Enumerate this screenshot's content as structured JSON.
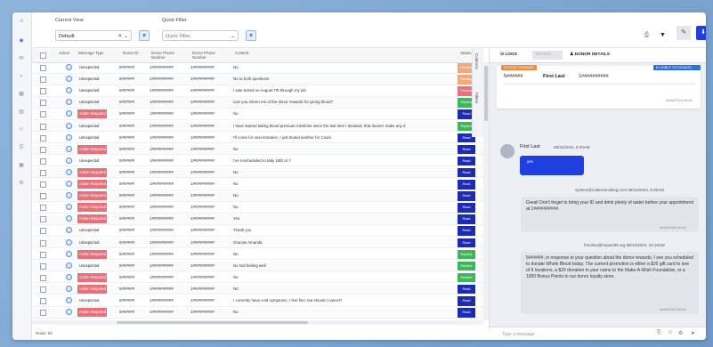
{
  "filters": {
    "current_view_label": "Current View",
    "current_view_value": "Default",
    "quick_filter_label": "Quick Filter",
    "quick_filter_value": "Quick Filter"
  },
  "grid": {
    "headers": [
      "Action",
      "Message Type",
      "Donor ID",
      "Donor Phone Number",
      "Donor Phone Number",
      "Content",
      "Status"
    ],
    "rows": [
      {
        "type": "Unexpected",
        "req": false,
        "d1": "5######",
        "d2": "1##########",
        "d3": "1##########",
        "content": "No",
        "status": "Pending",
        "color": "#f0a97a"
      },
      {
        "type": "Unexpected",
        "req": false,
        "d1": "5######",
        "d2": "1##########",
        "d3": "1##########",
        "content": "No to both questions",
        "status": "Pending",
        "color": "#f0a97a"
      },
      {
        "type": "Unexpected",
        "req": false,
        "d1": "5######",
        "d2": "1##########",
        "d3": "1##########",
        "content": "I was tested on August 7th through my job.",
        "status": "Pending",
        "color": "#e8707a"
      },
      {
        "type": "Unexpected",
        "req": false,
        "d1": "5######",
        "d2": "1##########",
        "d3": "1##########",
        "content": "Can you inform me of the donor rewards for giving blood?",
        "status": "Replied",
        "color": "#3fb55b"
      },
      {
        "type": "Action Required",
        "req": true,
        "d1": "5######",
        "d2": "1##########",
        "d3": "1##########",
        "content": "No",
        "status": "Read",
        "color": "#1d2bb0"
      },
      {
        "type": "Unexpected",
        "req": false,
        "d1": "5######",
        "d2": "1##########",
        "d3": "1##########",
        "content": "I have started taking blood pressure medicine since the last time I donated, that doesn't make any d",
        "status": "Replied",
        "color": "#3fb55b"
      },
      {
        "type": "Unexpected",
        "req": false,
        "d1": "5######",
        "d2": "1##########",
        "d3": "1##########",
        "content": "I'll come for next donation, I just texted another for Covid",
        "status": "Read",
        "color": "#1d2bb0"
      },
      {
        "type": "Action Required",
        "req": true,
        "d1": "5######",
        "d2": "1##########",
        "d3": "1##########",
        "content": "No",
        "status": "Read",
        "color": "#1d2bb0"
      },
      {
        "type": "Unexpected",
        "req": false,
        "d1": "5######",
        "d2": "1##########",
        "d3": "1##########",
        "content": "I've rescheduled to May 18th at 7",
        "status": "Read",
        "color": "#1d2bb0"
      },
      {
        "type": "Action Required",
        "req": true,
        "d1": "5######",
        "d2": "1##########",
        "d3": "1##########",
        "content": "No",
        "status": "Read",
        "color": "#1d2bb0"
      },
      {
        "type": "Action Required",
        "req": true,
        "d1": "5######",
        "d2": "1##########",
        "d3": "1##########",
        "content": "No",
        "status": "Read",
        "color": "#1d2bb0"
      },
      {
        "type": "Action Required",
        "req": true,
        "d1": "5######",
        "d2": "1##########",
        "d3": "1##########",
        "content": "No",
        "status": "Read",
        "color": "#1d2bb0"
      },
      {
        "type": "Action Required",
        "req": true,
        "d1": "5######",
        "d2": "1##########",
        "d3": "1##########",
        "content": "No",
        "status": "Read",
        "color": "#1d2bb0"
      },
      {
        "type": "Action Required",
        "req": true,
        "d1": "5######",
        "d2": "1##########",
        "d3": "1##########",
        "content": "Yes",
        "status": "Read",
        "color": "#1d2bb0"
      },
      {
        "type": "Unexpected",
        "req": false,
        "d1": "5######",
        "d2": "1##########",
        "d3": "1##########",
        "content": "Thank you",
        "status": "Read",
        "color": "#1d2bb0"
      },
      {
        "type": "Unexpected",
        "req": false,
        "d1": "5######",
        "d2": "1##########",
        "d3": "1##########",
        "content": "Gracias Amanda",
        "status": "Read",
        "color": "#1d2bb0"
      },
      {
        "type": "Action Required",
        "req": true,
        "d1": "5######",
        "d2": "1##########",
        "d3": "1##########",
        "content": "No",
        "status": "Replied",
        "color": "#3fb55b"
      },
      {
        "type": "Unexpected",
        "req": false,
        "d1": "5######",
        "d2": "1##########",
        "d3": "1##########",
        "content": "No Not feeling well",
        "status": "Replied",
        "color": "#3fb55b"
      },
      {
        "type": "Action Required",
        "req": true,
        "d1": "5######",
        "d2": "1##########",
        "d3": "1##########",
        "content": "No",
        "status": "Replied",
        "color": "#3fb55b"
      },
      {
        "type": "Action Required",
        "req": true,
        "d1": "5######",
        "d2": "1##########",
        "d3": "1##########",
        "content": "No",
        "status": "Read",
        "color": "#1d2bb0"
      },
      {
        "type": "Unexpected",
        "req": false,
        "d1": "5######",
        "d2": "1##########",
        "d3": "1##########",
        "content": "I currently have cold symptoms. I feel fine, but should I cancel?",
        "status": "Read",
        "color": "#1d2bb0"
      },
      {
        "type": "Action Required",
        "req": true,
        "d1": "5######",
        "d2": "1##########",
        "d3": "1##########",
        "content": "No",
        "status": "Read",
        "color": "#1d2bb0"
      }
    ],
    "rows_label": "Rows: 50",
    "side_tabs": [
      "Columns",
      "Filters"
    ]
  },
  "panel": {
    "tabs": [
      "LOGS",
      "NOTES",
      "DONOR DETAILS"
    ],
    "donor_chip_left": "STATUS: PENDING",
    "donor_chip_right": "ELIGIBLE TO DONATE: YES",
    "donor_id": "5######",
    "donor_name": "First Last",
    "donor_phone": "1##########",
    "card_ts": "##/##/2024 ##:##",
    "incoming_name": "First Last",
    "incoming_meta": "08/15/2024, 5:20AM",
    "incoming_text": "yes",
    "out1_header": "system@collectionsblog.com 08/12/2024, 5:30AM",
    "out1_text": "Great! Don't forget to bring your ID and drink plenty of water before your appointment at 1##########.",
    "out1_ts": "##/##/2024 ##:##",
    "out2_header": "hmolina@impact99.org 08/12/2024, 10:19AM",
    "out2_text": "5######, in response to your question about the donor rewards, I see you scheduled to donate Whole Blood today. The current promotion is either a $20 gift card to one of 9 locations, a $20 donation in your name to the Make-A-Wish Foundation, or a 1000 Bonus Points to our donor loyalty store.",
    "out2_ts": "##/##/2024 ##:##",
    "message_placeholder": "Type a message"
  },
  "colors": {
    "accent": "#2148d6",
    "pending": "#f0a97a",
    "replied": "#3fb55b",
    "read": "#1d2bb0",
    "required": "#e8707a"
  }
}
